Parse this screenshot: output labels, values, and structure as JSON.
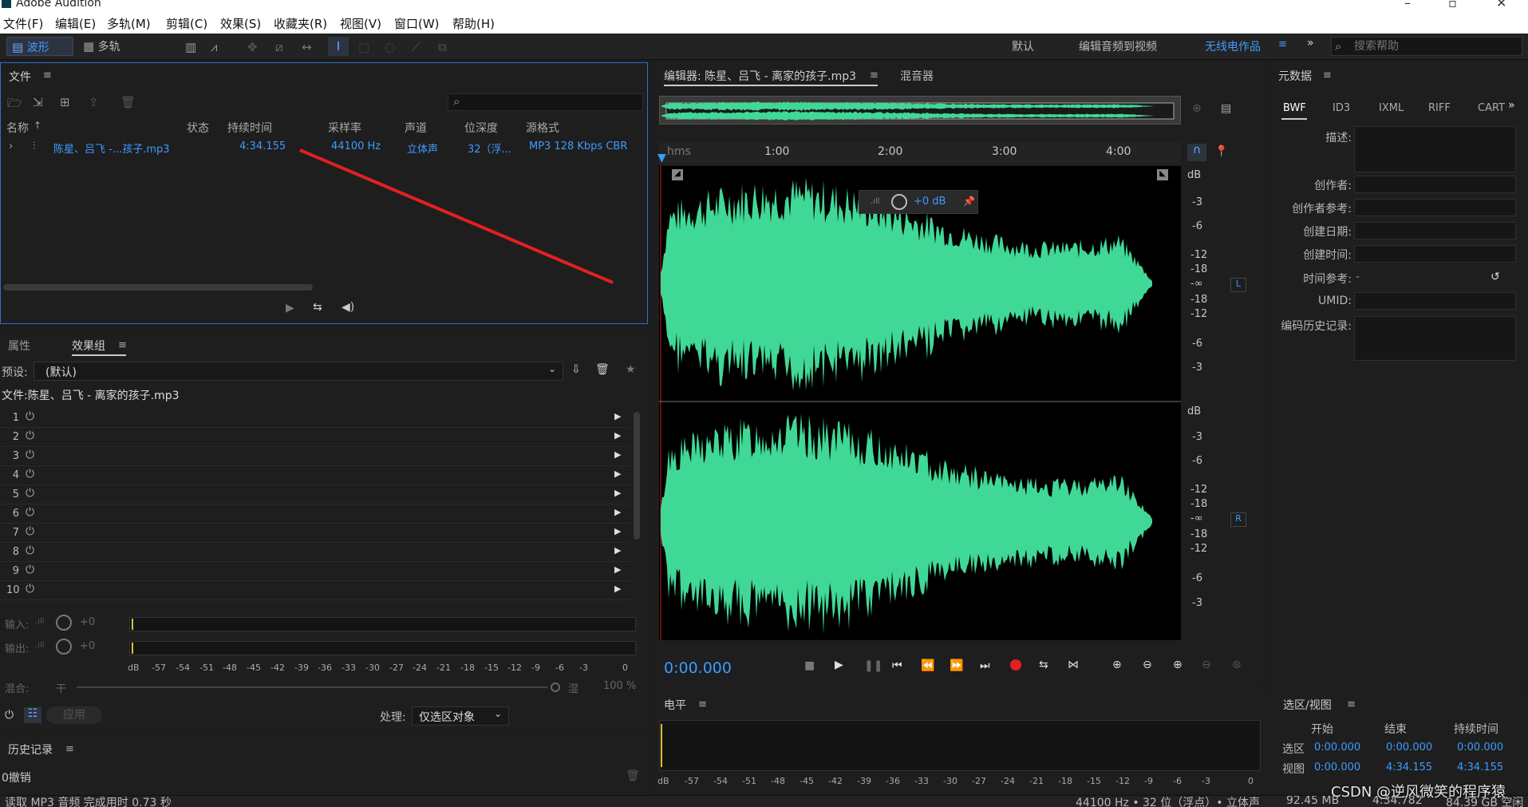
{
  "app": {
    "title": "Adobe Audition"
  },
  "menu": [
    "文件(F)",
    "编辑(E)",
    "多轨(M)",
    "剪辑(C)",
    "效果(S)",
    "收藏夹(R)",
    "视图(V)",
    "窗口(W)",
    "帮助(H)"
  ],
  "toolbar": {
    "waveform_label": "波形",
    "multitrack_label": "多轨",
    "workspaces": [
      "默认",
      "编辑音频到视频",
      "无线电作品"
    ],
    "search_placeholder": "搜索帮助"
  },
  "files": {
    "title": "文件",
    "columns": [
      "名称",
      "状态",
      "持续时间",
      "采样率",
      "声道",
      "位深度",
      "源格式"
    ],
    "rows": [
      {
        "name": "陈星、吕飞 -...孩子.mp3",
        "status": "",
        "duration": "4:34.155",
        "rate": "44100 Hz",
        "channels": "立体声",
        "depth": "32（浮...",
        "format": "MP3 128 Kbps CBR"
      }
    ]
  },
  "effects": {
    "tab_props": "属性",
    "tab_rack": "效果组",
    "preset_label": "预设:",
    "preset_value": "(默认)",
    "file_label": "文件:陈星、吕飞 - 离家的孩子.mp3",
    "slots": [
      "1",
      "2",
      "3",
      "4",
      "5",
      "6",
      "7",
      "8",
      "9",
      "10"
    ],
    "input_label": "输入:",
    "output_label": "输出:",
    "gain_value": "+0",
    "meter_ticks": [
      "dB",
      "-57",
      "-54",
      "-51",
      "-48",
      "-45",
      "-42",
      "-39",
      "-36",
      "-33",
      "-30",
      "-27",
      "-24",
      "-21",
      "-18",
      "-15",
      "-12",
      "-9",
      "-6",
      "-3",
      "0"
    ],
    "mix_label": "混合:",
    "mix_dry": "干",
    "mix_wet": "湿",
    "mix_value": "100 %",
    "apply_label": "应用",
    "process_label": "处理:",
    "process_value": "仅选区对象"
  },
  "history": {
    "title": "历史记录",
    "entry": "0撤销"
  },
  "status": {
    "left": "读取 MP3 音频 完成用时 0.73 秒",
    "right": [
      "44100 Hz • 32 位（浮点）• 立体声",
      "92.45 MB",
      "4:34.782",
      "84.39 GB 空闲"
    ]
  },
  "editor": {
    "tab_editor": "编辑器: 陈星、吕飞 - 离家的孩子.mp3",
    "tab_mixer": "混音器",
    "ruler_unit": "hms",
    "ruler_labels": [
      "1:00",
      "2:00",
      "3:00",
      "4:00"
    ],
    "hud_gain": "+0 dB",
    "db_label": "dB",
    "db_scale": [
      "-3",
      "-6",
      "-12",
      "-18",
      "-∞",
      "-18",
      "-12",
      "-6",
      "-3"
    ],
    "ch_left": "L",
    "ch_right": "R",
    "time": "0:00.000",
    "wave_color": "#40d896",
    "annotation_color": "#e32020"
  },
  "level": {
    "title": "电平",
    "ticks": [
      "dB",
      "-57",
      "-54",
      "-51",
      "-48",
      "-45",
      "-42",
      "-39",
      "-36",
      "-33",
      "-30",
      "-27",
      "-24",
      "-21",
      "-18",
      "-15",
      "-12",
      "-9",
      "-6",
      "-3",
      "0"
    ]
  },
  "metadata": {
    "title": "元数据",
    "tabs": [
      "BWF",
      "ID3",
      "IXML",
      "RIFF",
      "CART"
    ],
    "fields": [
      "描述:",
      "创作者:",
      "创作者参考:",
      "创建日期:",
      "创建时间:",
      "时间参考:",
      "UMID:",
      "编码历史记录:"
    ],
    "time_ref_value": "-"
  },
  "selection": {
    "title": "选区/视图",
    "cols": [
      "开始",
      "结束",
      "持续时间"
    ],
    "rows": [
      {
        "label": "选区",
        "start": "0:00.000",
        "end": "0:00.000",
        "dur": "0:00.000"
      },
      {
        "label": "视图",
        "start": "0:00.000",
        "end": "4:34.155",
        "dur": "4:34.155"
      }
    ]
  },
  "watermark": "CSDN @逆风微笑的程序猿"
}
